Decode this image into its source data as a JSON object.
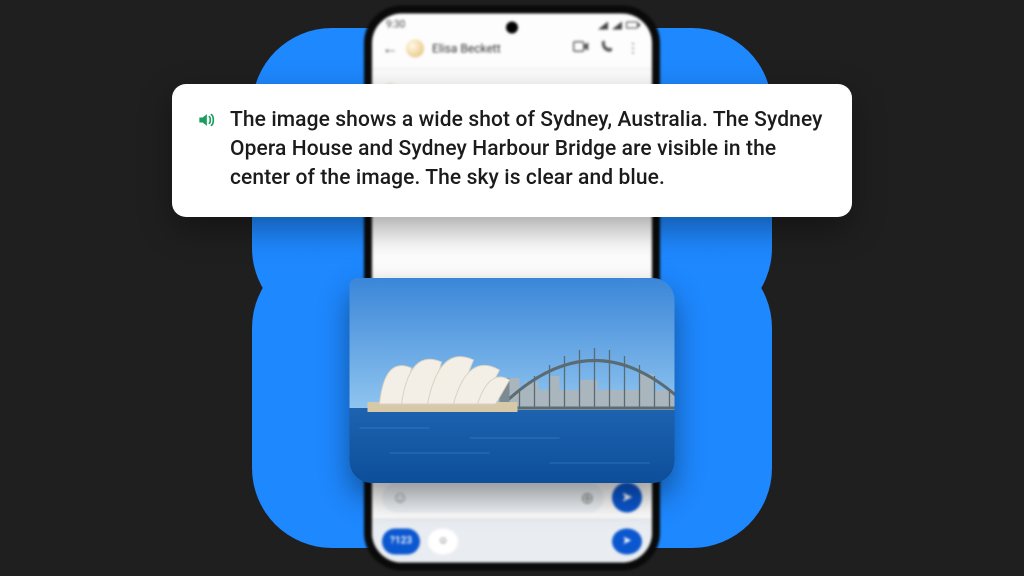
{
  "status_bar": {
    "time": "9:30"
  },
  "header": {
    "contact_name": "Elisa Beckett"
  },
  "callout": {
    "text": "The image shows a wide shot of Sydney, Australia. The Sydney Opera House and Sydney Harbour Bridge are visible in the center of the image. The sky is clear and blue."
  },
  "keyboard": {
    "numeric_key": "?123"
  },
  "image": {
    "alt": "Sydney Opera House and Harbour Bridge under clear blue sky"
  }
}
